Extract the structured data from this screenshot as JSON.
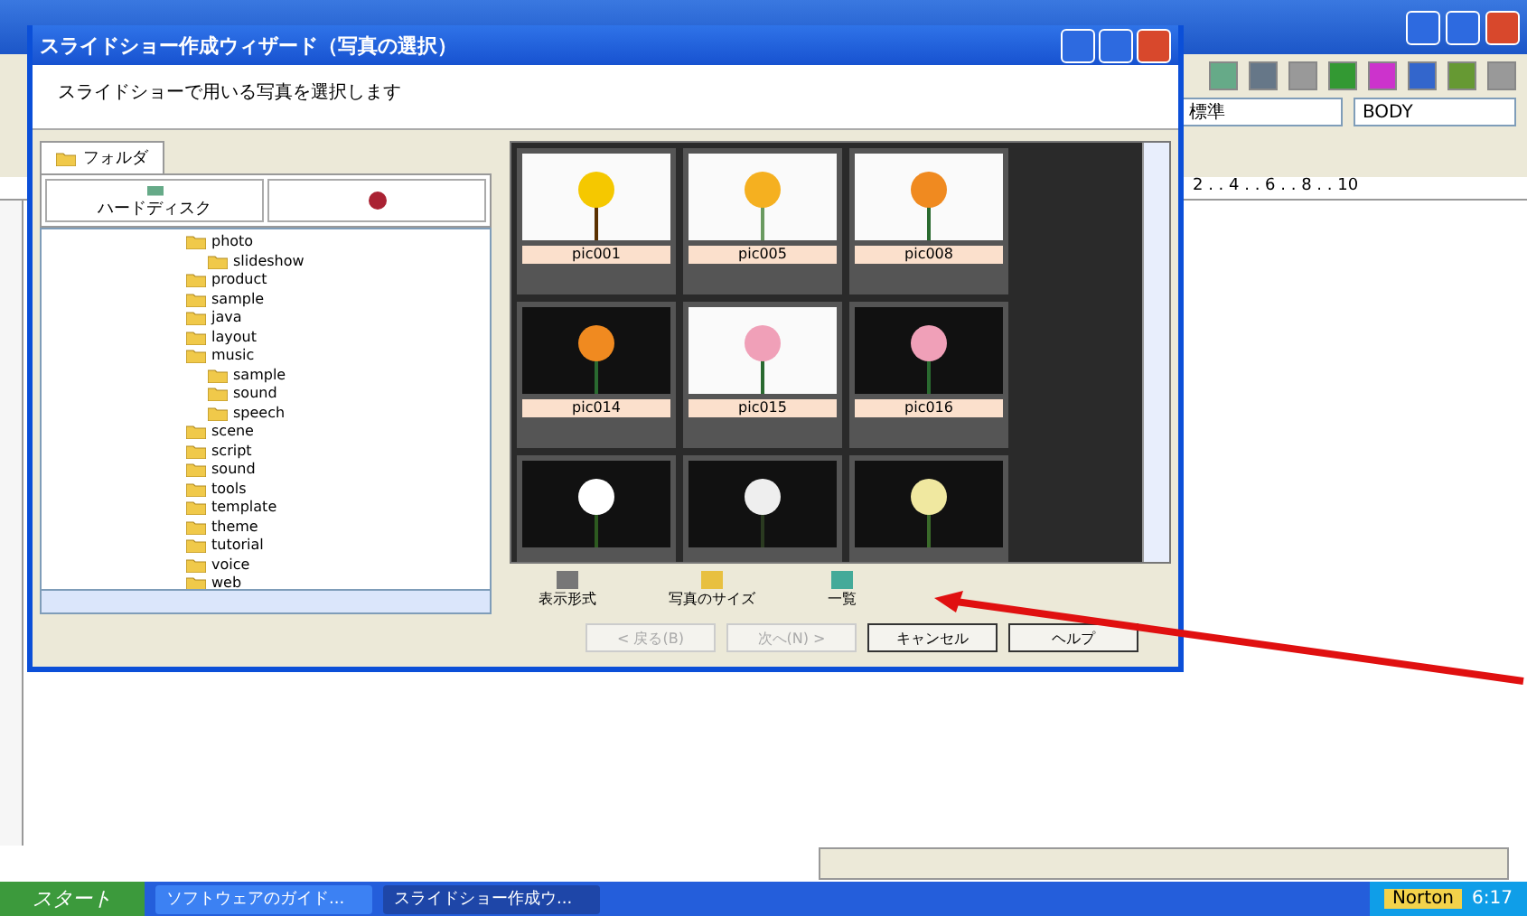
{
  "app_window": {
    "combo_style": "標準",
    "combo_tag": "BODY",
    "ruler": "2 . . 4 . . 6 . . 8 . . 10"
  },
  "dialog": {
    "title": "スライドショー作成ウィザード（写真の選択）",
    "instruction": "スライドショーで用いる写真を選択します",
    "tabs": [
      {
        "label": "フォルダ",
        "selected": true
      }
    ],
    "source_buttons": [
      {
        "label": "ハードディスク",
        "kind": "disk"
      },
      {
        "kind": "flower"
      }
    ],
    "tree": [
      {
        "label": "photo",
        "children": [
          {
            "label": "slideshow"
          }
        ]
      },
      {
        "label": "product"
      },
      {
        "label": "sample"
      },
      {
        "label": "java"
      },
      {
        "label": "layout"
      },
      {
        "label": "music",
        "children": [
          {
            "label": "sample"
          },
          {
            "label": "sound"
          },
          {
            "label": "speech"
          }
        ]
      },
      {
        "label": "scene"
      },
      {
        "label": "script"
      },
      {
        "label": "sound"
      },
      {
        "label": "tools"
      },
      {
        "label": "template"
      },
      {
        "label": "theme"
      },
      {
        "label": "tutorial"
      },
      {
        "label": "voice"
      },
      {
        "label": "web"
      }
    ],
    "thumbnails": [
      {
        "label": "pic001",
        "kind": "sunflower",
        "dark": false
      },
      {
        "label": "pic005",
        "kind": "yellow",
        "dark": false
      },
      {
        "label": "pic008",
        "kind": "bird",
        "dark": false
      },
      {
        "label": "pic014",
        "kind": "bird",
        "dark": true
      },
      {
        "label": "pic015",
        "kind": "rose",
        "dark": false
      },
      {
        "label": "pic016",
        "kind": "rose",
        "dark": true
      },
      {
        "kind": "lily",
        "dark": true
      },
      {
        "kind": "white",
        "dark": true
      },
      {
        "kind": "garden",
        "dark": true
      }
    ],
    "view_options": [
      {
        "label": "表示形式",
        "kind": "grid"
      },
      {
        "label": "写真のサイズ",
        "kind": "picture"
      },
      {
        "label": "一覧",
        "kind": "list"
      }
    ],
    "buttons": [
      {
        "label": "< 戻る(B)",
        "disabled": true
      },
      {
        "label": "次へ(N) >",
        "disabled": true
      },
      {
        "label": "キャンセル",
        "disabled": false
      },
      {
        "label": "ヘルプ",
        "disabled": false
      }
    ]
  },
  "taskbar": {
    "start": "スタート",
    "tasks": [
      {
        "label": "ソフトウェアのガイド...",
        "selected": false
      },
      {
        "label": "スライドショー作成ウ...",
        "selected": true
      }
    ],
    "norton": "Norton",
    "clock": "6:17"
  }
}
